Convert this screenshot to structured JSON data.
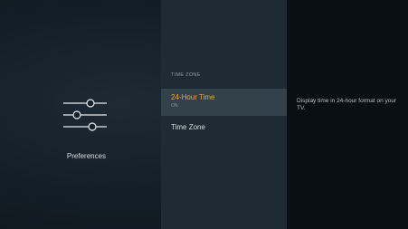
{
  "category": {
    "label": "Preferences",
    "icon": "sliders-icon"
  },
  "menu": {
    "section_header": "TIME ZONE",
    "items": [
      {
        "title": "24-Hour Time",
        "value": "ON",
        "selected": true
      },
      {
        "title": "Time Zone",
        "selected": false
      }
    ]
  },
  "detail": {
    "description": "Display time in 24-hour format on your TV."
  },
  "colors": {
    "accent": "#f2a72e",
    "selected_bg": "#33414b",
    "middle_bg": "#1e2b33",
    "right_bg": "#0a0f13"
  }
}
